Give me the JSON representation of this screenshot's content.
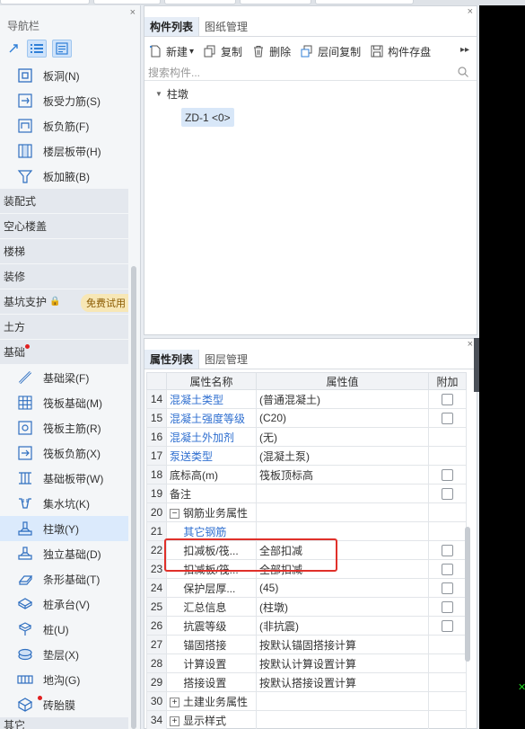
{
  "nav": {
    "title": "导航栏",
    "close": "×",
    "items_top": [
      {
        "label": "板洞(N)",
        "icon": "slab-hole-icon"
      },
      {
        "label": "板受力筋(S)",
        "icon": "slab-rebar-icon"
      },
      {
        "label": "板负筋(F)",
        "icon": "negative-rebar-icon"
      },
      {
        "label": "楼层板带(H)",
        "icon": "floor-strip-icon"
      },
      {
        "label": "板加腋(B)",
        "icon": "haunch-icon"
      }
    ],
    "categories": [
      "装配式",
      "空心楼盖",
      "楼梯",
      "装修"
    ],
    "foundation_support": {
      "label": "基坑支护",
      "lock": "🔒",
      "badge": "免费试用"
    },
    "earthwork": "土方",
    "foundation": "基础",
    "items_bottom": [
      {
        "label": "基础梁(F)",
        "icon": "foundation-beam-icon"
      },
      {
        "label": "筏板基础(M)",
        "icon": "raft-foundation-icon"
      },
      {
        "label": "筏板主筋(R)",
        "icon": "raft-main-rebar-icon"
      },
      {
        "label": "筏板负筋(X)",
        "icon": "raft-negative-rebar-icon"
      },
      {
        "label": "基础板带(W)",
        "icon": "foundation-strip-icon"
      },
      {
        "label": "集水坑(K)",
        "icon": "sump-pit-icon"
      },
      {
        "label": "柱墩(Y)",
        "icon": "column-pier-icon",
        "selected": true
      },
      {
        "label": "独立基础(D)",
        "icon": "isolated-footing-icon"
      },
      {
        "label": "条形基础(T)",
        "icon": "strip-footing-icon"
      },
      {
        "label": "桩承台(V)",
        "icon": "pile-cap-icon"
      },
      {
        "label": "桩(U)",
        "icon": "pile-icon"
      },
      {
        "label": "垫层(X)",
        "icon": "cushion-icon"
      },
      {
        "label": "地沟(G)",
        "icon": "trench-icon"
      },
      {
        "label": "砖胎膜",
        "icon": "brick-mold-icon",
        "dot": true
      }
    ],
    "bottom_cut": "其它"
  },
  "component_panel": {
    "tabs": [
      "构件列表",
      "图纸管理"
    ],
    "toolbar": [
      "新建",
      "复制",
      "删除",
      "层间复制",
      "构件存盘"
    ],
    "new_arrow": "▾",
    "more": "▸▸",
    "search_placeholder": "搜索构件...",
    "tree_root": "柱墩",
    "tree_node": "ZD-1 <0>"
  },
  "property_panel": {
    "tabs": [
      "属性列表",
      "图层管理"
    ],
    "headers": [
      "属性名称",
      "属性值",
      "附加"
    ],
    "rows": [
      {
        "n": "14",
        "name": "混凝土类型",
        "value": "(普通混凝土)",
        "blue": true,
        "check": true
      },
      {
        "n": "15",
        "name": "混凝土强度等级",
        "value": "(C20)",
        "blue": true,
        "check": true
      },
      {
        "n": "16",
        "name": "混凝土外加剂",
        "value": "(无)",
        "blue": true,
        "check": false
      },
      {
        "n": "17",
        "name": "泵送类型",
        "value": "(混凝土泵)",
        "blue": true,
        "check": false
      },
      {
        "n": "18",
        "name": "底标高(m)",
        "value": "筏板顶标高",
        "blue": false,
        "check": true
      },
      {
        "n": "19",
        "name": "备注",
        "value": "",
        "blue": false,
        "check": true
      },
      {
        "n": "20",
        "name": "钢筋业务属性",
        "value": "",
        "blue": false,
        "check": false,
        "group": "minus"
      },
      {
        "n": "21",
        "name": "其它钢筋",
        "value": "",
        "blue": true,
        "check": false,
        "indent": true
      },
      {
        "n": "22",
        "name": "扣减板/筏...",
        "value": "全部扣减",
        "blue": false,
        "check": true,
        "indent": true
      },
      {
        "n": "23",
        "name": "扣减板/筏...",
        "value": "全部扣减",
        "blue": false,
        "check": true,
        "indent": true
      },
      {
        "n": "24",
        "name": "保护层厚...",
        "value": "(45)",
        "blue": false,
        "check": true,
        "indent": true
      },
      {
        "n": "25",
        "name": "汇总信息",
        "value": "(柱墩)",
        "blue": false,
        "check": true,
        "indent": true
      },
      {
        "n": "26",
        "name": "抗震等级",
        "value": "(非抗震)",
        "blue": false,
        "check": true,
        "indent": true
      },
      {
        "n": "27",
        "name": "锚固搭接",
        "value": "按默认锚固搭接计算",
        "blue": false,
        "check": false,
        "indent": true
      },
      {
        "n": "28",
        "name": "计算设置",
        "value": "按默认计算设置计算",
        "blue": false,
        "check": false,
        "indent": true
      },
      {
        "n": "29",
        "name": "搭接设置",
        "value": "按默认搭接设置计算",
        "blue": false,
        "check": false,
        "indent": true
      },
      {
        "n": "30",
        "name": "土建业务属性",
        "value": "",
        "blue": false,
        "check": false,
        "group": "plus"
      },
      {
        "n": "34",
        "name": "显示样式",
        "value": "",
        "blue": false,
        "check": false,
        "group": "plus"
      }
    ]
  },
  "colors": {
    "accent": "#2f6fd0",
    "highlight_box": "#e0302a",
    "selected_bg": "#dbeafc"
  }
}
